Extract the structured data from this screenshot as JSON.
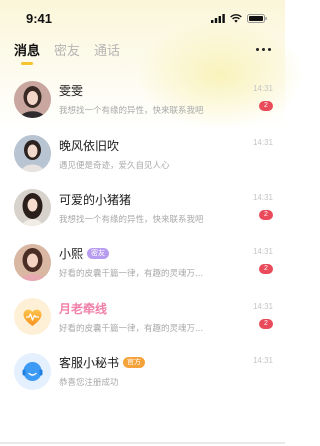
{
  "status_bar": {
    "time": "9:41"
  },
  "tabs": [
    {
      "label": "消息",
      "active": true
    },
    {
      "label": "密友",
      "active": false
    },
    {
      "label": "通话",
      "active": false
    }
  ],
  "conversations": [
    {
      "name": "雯雯",
      "message": "我想找一个有缘的异性，快来联系我吧",
      "time": "14:31",
      "unread": "2",
      "avatar": "photo-avatar",
      "tag": ""
    },
    {
      "name": "晚风依旧吹",
      "message": "遇见便是奇迹，爱久自见人心",
      "time": "14:31",
      "unread": "",
      "avatar": "photo-avatar",
      "tag": ""
    },
    {
      "name": "可爱的小猪猪",
      "message": "我想找一个有缘的异性，快来联系我吧",
      "time": "14:31",
      "unread": "2",
      "avatar": "photo-avatar",
      "tag": ""
    },
    {
      "name": "小熙",
      "message": "好看的皮囊千篇一律，有趣的灵魂万...",
      "time": "14:31",
      "unread": "2",
      "avatar": "photo-avatar",
      "tag": "密友"
    },
    {
      "name": "月老牵线",
      "message": "好看的皮囊千篇一律，有趣的灵魂万...",
      "time": "14:31",
      "unread": "2",
      "avatar": "heart-icon",
      "tag": ""
    },
    {
      "name": "客服小秘书",
      "message": "恭喜您注册成功",
      "time": "14:31",
      "unread": "",
      "avatar": "headset-icon",
      "tag": "官方"
    }
  ],
  "colors": {
    "accent": "#f4c430",
    "unread": "#ea4b5a",
    "tag_purple": "#b79cf0",
    "tag_orange": "#f6a23a",
    "matchmaker": "#f080a8"
  }
}
